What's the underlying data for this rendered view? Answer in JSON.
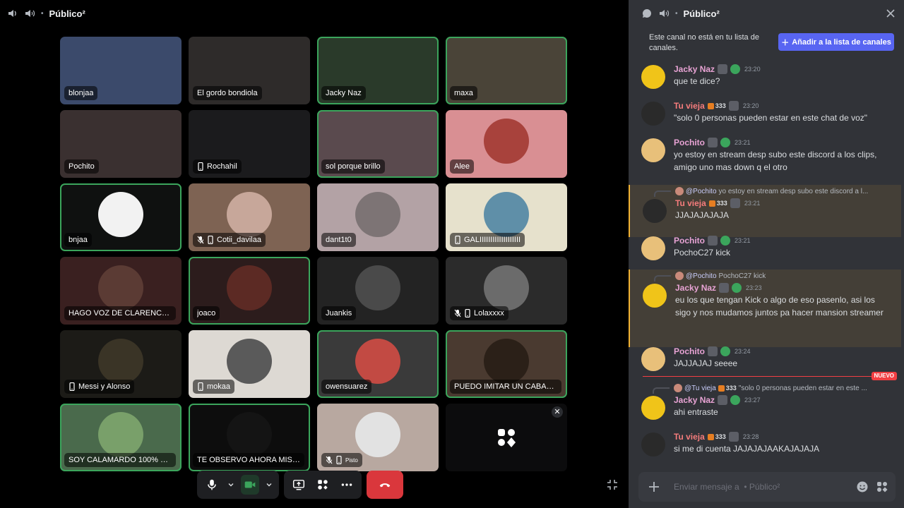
{
  "stage": {
    "channel_name": "Público²",
    "tiles": [
      {
        "name": "blonjaa",
        "bg": "#3b4a6b",
        "speaking": false,
        "mic": "",
        "device": ""
      },
      {
        "name": "El gordo bondiola",
        "bg": "#2e2b2a",
        "speaking": false,
        "mic": "",
        "device": ""
      },
      {
        "name": "Jacky Naz",
        "bg": "#2a3a2a",
        "speaking": true,
        "mic": "",
        "device": ""
      },
      {
        "name": "maxa",
        "bg": "#4a4438",
        "speaking": true,
        "mic": "",
        "device": ""
      },
      {
        "name": "Pochito",
        "bg": "#3a3030",
        "speaking": false,
        "mic": "",
        "device": ""
      },
      {
        "name": "Rochahil",
        "bg": "#1b1b1d",
        "speaking": false,
        "mic": "",
        "device": "mobile"
      },
      {
        "name": "sol porque brillo",
        "bg": "#5a4a4e",
        "speaking": true,
        "mic": "",
        "device": ""
      },
      {
        "name": "Alee",
        "bg": "#d98f93",
        "speaking": false,
        "mic": "",
        "device": "",
        "circle": "#a8423c"
      },
      {
        "name": "bnjaa",
        "bg": "#0f1110",
        "speaking": true,
        "mic": "",
        "device": "",
        "circle": "#f2f2f2"
      },
      {
        "name": "Cotii_davilaa",
        "bg": "#7e6353",
        "speaking": false,
        "mic": "muted",
        "device": "mobile",
        "circle": "#c7a79a"
      },
      {
        "name": "dant1t0",
        "bg": "#b3a2a5",
        "speaking": false,
        "mic": "",
        "device": "",
        "circle": "#7d7475"
      },
      {
        "name": "GALI",
        "name_full": "GALIIIIIIIIIIIIIIIIIII",
        "bg": "#e6e1cc",
        "speaking": false,
        "mic": "",
        "device": "mobile",
        "circle": "#5f8fa8"
      },
      {
        "name": "HAGO VOZ DE CLARENCE Y H...",
        "bg": "#3a2020",
        "speaking": false,
        "mic": "",
        "device": "",
        "circle": "#5b3b34"
      },
      {
        "name": "joaco",
        "bg": "#2c1c1c",
        "speaking": true,
        "mic": "",
        "device": "",
        "circle": "#5c2a24"
      },
      {
        "name": "Juankis",
        "bg": "#232323",
        "speaking": false,
        "mic": "",
        "device": "",
        "circle": "#4a4a4a"
      },
      {
        "name": "Lolaxxxx",
        "bg": "#2b2b2b",
        "speaking": false,
        "mic": "muted",
        "device": "mobile",
        "circle": "#6b6b6b"
      },
      {
        "name": "Messi y Alonso",
        "bg": "#1c1b17",
        "speaking": false,
        "mic": "",
        "device": "mobile",
        "circle": "#3a3426"
      },
      {
        "name": "mokaa",
        "bg": "#ddd9d3",
        "speaking": false,
        "mic": "",
        "device": "mobile",
        "circle": "#5a5a5a"
      },
      {
        "name": "owensuarez",
        "bg": "#3a3a3a",
        "speaking": true,
        "mic": "",
        "device": "",
        "circle": "#c24a43"
      },
      {
        "name": "PUEDO IMITAR UN CABALLO ...",
        "bg": "#4a3a30",
        "speaking": true,
        "mic": "",
        "device": "",
        "circle": "#2b2018"
      },
      {
        "name": "SOY CALAMARDO 100% REAL",
        "bg": "#4a6a4c",
        "speaking": true,
        "mic": "",
        "device": "",
        "circle": "#79a06a"
      },
      {
        "name": "TE OBSERVO AHORA MISMO",
        "bg": "#0d0d0d",
        "speaking": true,
        "mic": "",
        "device": "",
        "circle": "#141414"
      },
      {
        "name": "Pisto",
        "bg": "#b8a8a0",
        "speaking": false,
        "mic": "muted",
        "device": "mobile",
        "circle": "#e2e2e2",
        "small": true
      }
    ],
    "controls": {
      "mic": "microphone-icon",
      "video": "video-camera-icon",
      "screen_share": "screen-share-icon",
      "activities": "activities-icon",
      "more": "more-icon",
      "hang_up": "hang-up-icon"
    }
  },
  "chat": {
    "channel_name": "Público²",
    "notice_text": "Este canal no está en tu lista de canales.",
    "add_button": "Añadir a la lista de canales",
    "new_label": "NUEVO",
    "messages": [
      {
        "author": "Jacky Naz",
        "color": "#e8a3d4",
        "tag": "",
        "time": "23:20",
        "text": "que te dice?",
        "reply_user": "",
        "reply_text": ""
      },
      {
        "author": "Tu vieja",
        "color": "#f57c7c",
        "tag": "333",
        "time": "23:20",
        "text": "\"solo 0 personas pueden estar en este chat de voz\"",
        "reply_user": "",
        "reply_text": ""
      },
      {
        "author": "Pochito",
        "color": "#e8a3d4",
        "tag": "",
        "time": "23:21",
        "text": "yo estoy en stream desp subo este discord a los clips, amigo uno mas down q el otro",
        "reply_user": "",
        "reply_text": ""
      },
      {
        "author": "Tu vieja",
        "color": "#f57c7c",
        "tag": "333",
        "time": "23:21",
        "text": "JJAJAJAJAJA",
        "reply_user": "@Pochito",
        "reply_text": "yo estoy en stream desp subo este discord a l..."
      },
      {
        "author": "Pochito",
        "color": "#e8a3d4",
        "tag": "",
        "time": "23:21",
        "text": "PochoC27 kick",
        "reply_user": "",
        "reply_text": ""
      },
      {
        "author": "Jacky Naz",
        "color": "#e8a3d4",
        "tag": "",
        "time": "23:23",
        "text": "eu los que tengan Kick o algo de eso pasenlo, asi los sigo y nos mudamos juntos pa hacer mansion streamer",
        "reply_user": "@Pochito",
        "reply_text": "PochoC27 kick"
      },
      {
        "author": "Pochito",
        "color": "#e8a3d4",
        "tag": "",
        "time": "23:24",
        "text": "JAJJAJAJ seeee",
        "reply_user": "",
        "reply_text": ""
      },
      {
        "author": "Jacky Naz",
        "color": "#e8a3d4",
        "tag": "",
        "time": "23:27",
        "text": "ahi entraste",
        "reply_user": "@Tu vieja",
        "reply_text": "\"solo 0 personas pueden estar en este ..."
      },
      {
        "author": "Tu vieja",
        "color": "#f57c7c",
        "tag": "333",
        "time": "23:28",
        "text": "si me di cuenta JAJAJAJAAKAJAJAJA",
        "reply_user": "",
        "reply_text": ""
      }
    ],
    "reply_tag": "333",
    "composer_placeholder": "Enviar mensaje a  • Público²"
  }
}
